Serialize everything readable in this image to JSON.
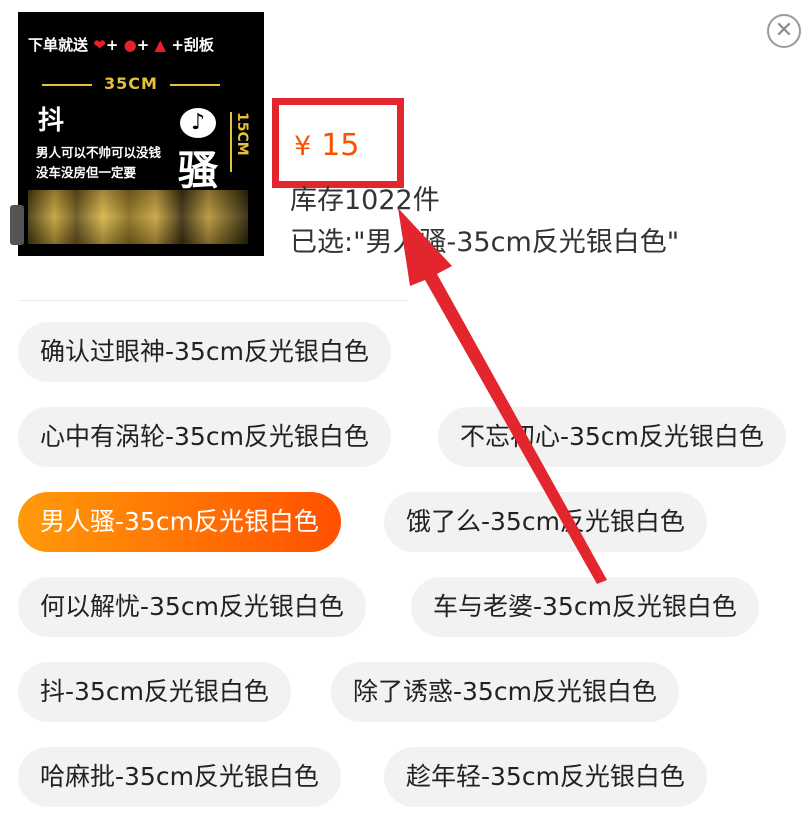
{
  "product": {
    "thumbnail": {
      "promo": "下单就送",
      "promo_extra": "+刮板",
      "width_label": "35CM",
      "title_char": "抖",
      "line1": "男人可以不帅可以没钱",
      "line2": "没车没房但一定要",
      "big_char": "骚",
      "height_label": "15CM"
    },
    "price_symbol": "¥",
    "price": "15",
    "stock": "库存1022件",
    "selected": "已选:\"男人骚-35cm反光银白色\""
  },
  "options": [
    {
      "label": "确认过眼神-35cm反光银白色",
      "active": false
    },
    {
      "label": "心中有涡轮-35cm反光银白色",
      "active": false
    },
    {
      "label": "不忘初心-35cm反光银白色",
      "active": false
    },
    {
      "label": "男人骚-35cm反光银白色",
      "active": true
    },
    {
      "label": "饿了么-35cm反光银白色",
      "active": false
    },
    {
      "label": "何以解忧-35cm反光银白色",
      "active": false
    },
    {
      "label": "车与老婆-35cm反光银白色",
      "active": false
    },
    {
      "label": "抖-35cm反光银白色",
      "active": false
    },
    {
      "label": "除了诱惑-35cm反光银白色",
      "active": false
    },
    {
      "label": "哈麻批-35cm反光银白色",
      "active": false
    },
    {
      "label": "趁年轻-35cm反光银白色",
      "active": false
    }
  ],
  "icons": {
    "close": "close-icon"
  },
  "colors": {
    "price": "#ff5000",
    "active_start": "#ff9a0a",
    "active_end": "#ff5000",
    "annotation_red": "#e3262d"
  }
}
